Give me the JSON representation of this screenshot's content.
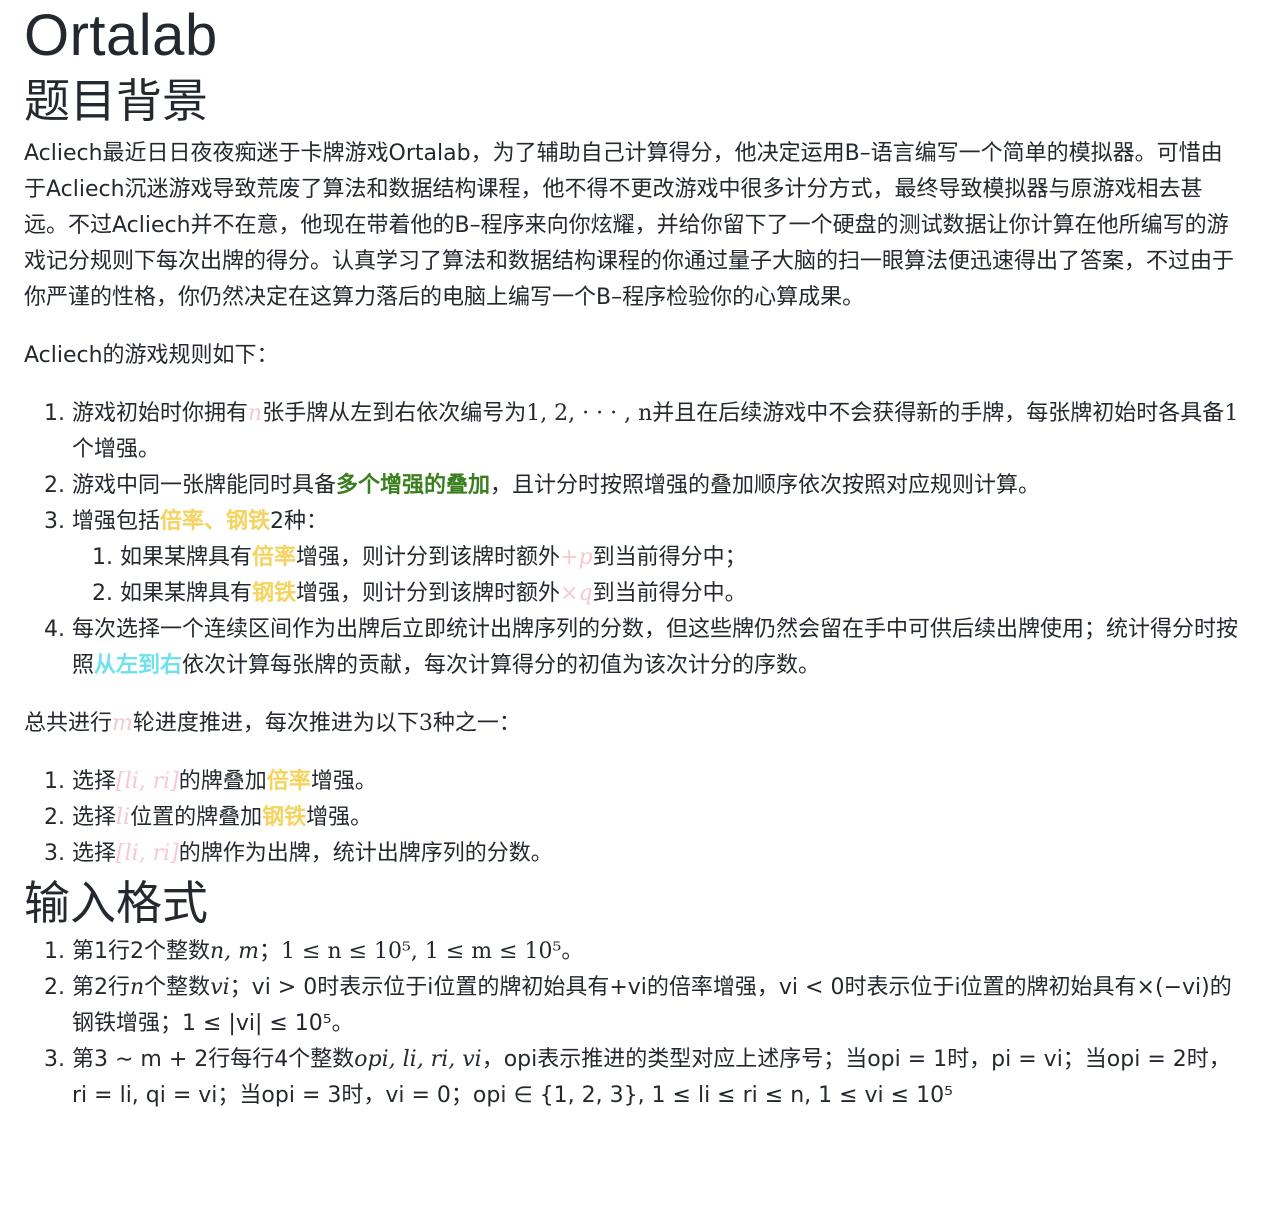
{
  "title": "Ortalab",
  "background": {
    "heading": "题目背景",
    "paragraph": "Acliech最近日日夜夜痴迷于卡牌游戏Ortalab，为了辅助自己计算得分，他决定运用B–语言编写一个简单的模拟器。可惜由于Acliech沉迷游戏导致荒废了算法和数据结构课程，他不得不更改游戏中很多计分方式，最终导致模拟器与原游戏相去甚远。不过Acliech并不在意，他现在带着他的B–程序来向你炫耀，并给你留下了一个硬盘的测试数据让你计算在他所编写的游戏记分规则下每次出牌的得分。认真学习了算法和数据结构课程的你通过量子大脑的扫一眼算法便迅速得出了答案，不过由于你严谨的性格，你仍然决定在这算力落后的电脑上编写一个B–程序检验你的心算成果。",
    "rules_intro": "Acliech的游戏规则如下："
  },
  "rules": {
    "r1": {
      "a": "游戏初始时你拥有",
      "n": "n",
      "b": "张手牌从左到右依次编号为",
      "seq": "1, 2, · · · , n",
      "c": "并且在后续游戏中不会获得新的手牌，每张牌初始时各具备",
      "one": "1",
      "d": "个增强。"
    },
    "r2": {
      "a": "游戏中同一张牌能同时具备",
      "hl": "多个增强的叠加",
      "b": "，且计分时按照增强的叠加顺序依次按照对应规则计算。"
    },
    "r3": {
      "a": "增强包括",
      "hl": "倍率、钢铁",
      "b": "2种：",
      "sub1": {
        "a": "如果某牌具有",
        "hl": "倍率",
        "b": "增强，则计分到该牌时额外",
        "expr": "+p",
        "c": "到当前得分中；"
      },
      "sub2": {
        "a": "如果某牌具有",
        "hl": "钢铁",
        "b": "增强，则计分到该牌时额外",
        "expr": "×q",
        "c": "到当前得分中。"
      }
    },
    "r4": {
      "a": "每次选择一个连续区间作为出牌后立即统计出牌序列的分数，但这些牌仍然会留在手中可供后续出牌使用；统计得分时按照",
      "hl": "从左到右",
      "b": "依次计算每张牌的贡献，每次计算得分的初值为该次计分的序数。"
    }
  },
  "progress": {
    "a": "总共进行",
    "m": "m",
    "b": "轮进度推进，每次推进为以下",
    "three": "3",
    "c": "种之一：",
    "ops": [
      {
        "a": "选择",
        "range": "[li, ri]",
        "b": "的牌叠加",
        "hl": "倍率",
        "c": "增强。"
      },
      {
        "a": "选择",
        "pos": "li",
        "b": "位置的牌叠加",
        "hl": "钢铁",
        "c": "增强。"
      },
      {
        "a": "选择",
        "range": "[li, ri]",
        "b": "的牌作为出牌，统计出牌序列的分数。"
      }
    ]
  },
  "input": {
    "heading": "输入格式",
    "i1": {
      "a": "第1行2个整数",
      "vars": "n, m",
      "b": "；",
      "cons": "1 ≤ n ≤ 10⁵, 1 ≤ m ≤ 10⁵",
      "c": "。"
    },
    "i2": {
      "a": "第2行",
      "n": "n",
      "b": "个整数",
      "v": "vi",
      "c": "；",
      "d": "vi > 0时表示位于i位置的牌初始具有+vi的倍率增强，vi < 0时表示位于i位置的牌初始具有×(−vi)的钢铁增强；1 ≤ |vi| ≤ 10⁵。"
    },
    "i3": {
      "a": "第3 ∼ m + 2行每行4个整数",
      "vars": "opi, li, ri, vi",
      "b": "，opi表示推进的类型对应上述序号；当opi = 1时，pi = vi；当opi = 2时，ri = li, qi = vi；当opi = 3时，vi = 0；opi ∈ {1, 2, 3}, 1 ≤ li ≤ ri ≤ n, 1 ≤ vi ≤ 10⁵"
    }
  }
}
